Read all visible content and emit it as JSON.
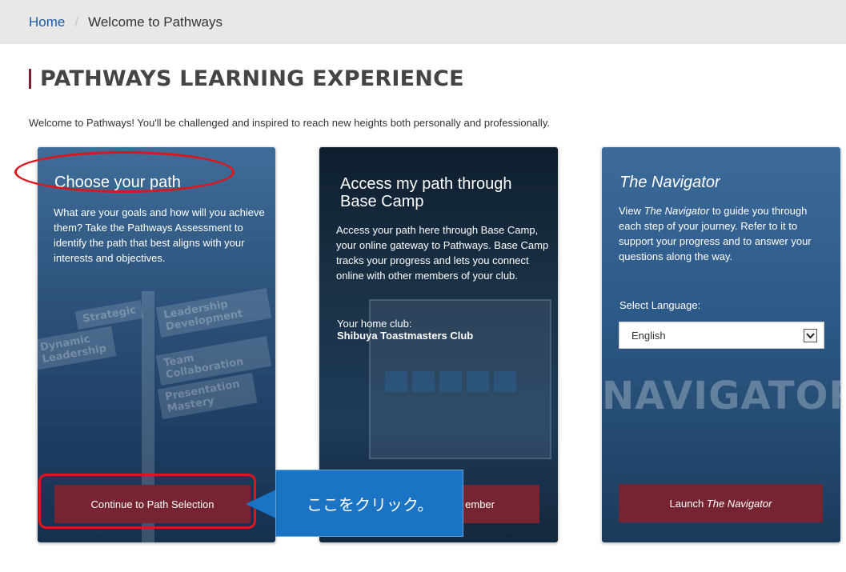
{
  "breadcrumb": {
    "home": "Home",
    "current": "Welcome to Pathways"
  },
  "page": {
    "title": "PATHWAYS LEARNING EXPERIENCE",
    "intro": "Welcome to Pathways! You'll be challenged and inspired to reach new heights both personally and professionally."
  },
  "cards": {
    "choose": {
      "title": "Choose your path",
      "body": "What are your goals and how will you achieve them? Take the Pathways Assessment to identify the path that best aligns with your interests and objectives.",
      "signs": [
        "Strategic",
        "Leadership Development",
        "Dynamic Leadership",
        "Team Collaboration",
        "Presentation Mastery"
      ],
      "button": "Continue to Path Selection"
    },
    "basecamp": {
      "title": "Access my path through Base Camp",
      "body": "Access your path here through Base Camp, your online gateway to Pathways. Base Camp tracks your progress and lets you connect online with other members of your club.",
      "home_label": "Your home club:",
      "home_club": "Shibuya Toastmasters Club",
      "button_visible": "ember"
    },
    "navigator": {
      "title": "The Navigator",
      "body_pre": "View ",
      "body_em": "The Navigator",
      "body_post": " to guide you through each step of your journey. Refer to it to support your progress and to answer your questions along the way.",
      "lang_label": "Select Language:",
      "lang_value": "English",
      "bg_word": "NAVIGATOR",
      "button_pre": "Launch ",
      "button_em": "The Navigator"
    }
  },
  "annotation": {
    "callout": "ここをクリック。",
    "color": "#e0141b",
    "callout_color": "#1b73c4"
  },
  "colors": {
    "brand": "#772432",
    "link": "#1a5aa8"
  }
}
